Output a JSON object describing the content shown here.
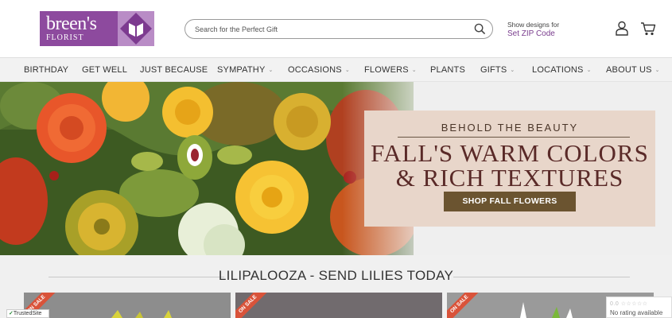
{
  "brand": {
    "name": "breen's",
    "sub": "FLORIST",
    "colors": {
      "primary": "#8d4a9e",
      "accent": "#b98cc6",
      "button": "#6b5430",
      "sale": "#d9533a"
    }
  },
  "search": {
    "placeholder": "Search for the Perfect Gift",
    "icon": "search-icon"
  },
  "zip": {
    "label": "Show designs for",
    "link": "Set ZIP Code"
  },
  "header_icons": [
    "user-icon",
    "cart-icon"
  ],
  "nav": [
    {
      "label": "BIRTHDAY",
      "caret": ""
    },
    {
      "label": "GET WELL",
      "caret": ""
    },
    {
      "label": "JUST BECAUSE",
      "caret": ""
    },
    {
      "label": "SYMPATHY",
      "caret": "⌄"
    },
    {
      "label": "OCCASIONS",
      "caret": "⌄"
    },
    {
      "label": "FLOWERS",
      "caret": "⌄"
    },
    {
      "label": "PLANTS",
      "caret": ""
    },
    {
      "label": "GIFTS",
      "caret": "⌄"
    },
    {
      "label": "LOCATIONS",
      "caret": "⌄"
    },
    {
      "label": "ABOUT US",
      "caret": "⌄"
    }
  ],
  "hero": {
    "kicker": "BEHOLD THE BEAUTY",
    "headline_1": "FALL'S WARM COLORS",
    "headline_2": "& RICH TEXTURES",
    "button": "SHOP FALL FLOWERS"
  },
  "section": {
    "title": "LILIPALOOZA - SEND LILIES TODAY",
    "products": [
      {
        "badge": "ON SALE"
      },
      {
        "badge": "ON SALE"
      },
      {
        "badge": "ON SALE"
      }
    ]
  },
  "trusted_site": {
    "a": "Trusted",
    "b": "Site"
  },
  "rating": {
    "score": "0.0",
    "stars": "☆☆☆☆☆",
    "text": "No rating available"
  }
}
